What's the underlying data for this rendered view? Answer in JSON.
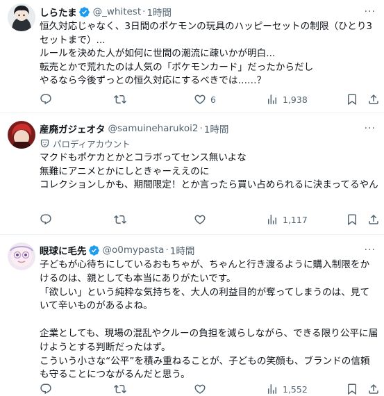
{
  "posts": [
    {
      "name": "しらたま",
      "handle": "@_whitest",
      "dot": "·",
      "time": "1時間",
      "more": "···",
      "body": "恒久対応じゃなく、3日間のポケモンの玩具のハッピーセットの制限（ひとり3セットまで）...\nルールを決めた人が如何に世間の潮流に疎いかが明白...\n転売とかで荒れたのは人気の「ポケモンカード」だったからだし\nやるなら今後ずっとの恒久対応にするべきでは……？",
      "replies": "",
      "reposts": "",
      "likes": "6",
      "views": "1,938"
    },
    {
      "name": "産廃ガジェオタ",
      "handle": "@samuineharukoi2",
      "dot": "·",
      "time": "1時間",
      "more": "···",
      "parody": "パロディアカウント",
      "body": "マクドもポケカとかとコラボってセンス無いよな\n無難にアニメとかにしときゃーええのに\nコレクションしかも、期間限定！とか言ったら買い占められるに決まってるやん",
      "replies": "",
      "reposts": "",
      "likes": "",
      "views": "1,117"
    },
    {
      "name": "眼球に毛先",
      "handle": "@o0mypasta",
      "dot": "·",
      "time": "1時間",
      "more": "···",
      "body": "子どもが心待ちにしているおもちゃが、ちゃんと行き渡るように購入制限をかけるのは、親としても本当にありがたいです。\n「欲しい」という純粋な気持ちを、大人の利益目的が奪ってしまうのは、見ていて辛いものがあるよね。\n\n企業としても、現場の混乱やクルーの負担を減らしながら、できる限り公平に届けようとする判断だったはず。\nこういう小さな“公平”を積み重ねることが、子どもの笑顔も、ブランドの信頼も守ることにつながるんだと思う。",
      "replies": "",
      "reposts": "",
      "likes": "",
      "views": "1,552"
    }
  ],
  "icons": [
    "verified-badge-icon",
    "more-icon",
    "parody-icon",
    "reply-icon",
    "repost-icon",
    "like-icon",
    "views-icon",
    "bookmark-icon",
    "share-icon"
  ],
  "colors": {
    "text": "#0f1419",
    "muted": "#536471",
    "verified": "#1d9bf0",
    "divider": "#eff3f4"
  }
}
